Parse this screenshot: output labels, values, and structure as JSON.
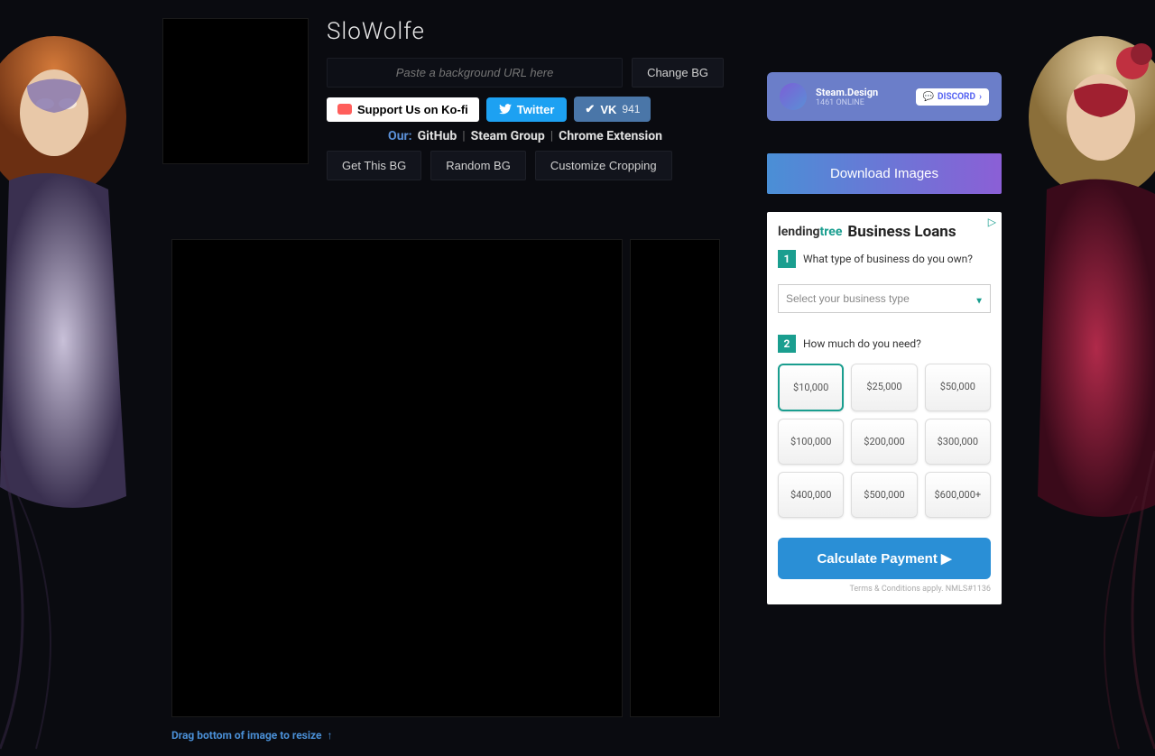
{
  "title": "SloWolfe",
  "urlInput": {
    "placeholder": "Paste a background URL here"
  },
  "buttons": {
    "changeBg": "Change BG",
    "kofi": "Support Us on Ko-fi",
    "twitter": "Twitter",
    "vk": "VK",
    "vkCount": "941",
    "getThisBg": "Get This BG",
    "randomBg": "Random BG",
    "customizeCropping": "Customize Cropping",
    "download": "Download Images"
  },
  "links": {
    "our": "Our:",
    "github": "GitHub",
    "steamGroup": "Steam Group",
    "chromeExtension": "Chrome Extension"
  },
  "discord": {
    "title": "Steam.Design",
    "sub": "1461 ONLINE",
    "label": "DISCORD"
  },
  "ad": {
    "logoText1": "lending",
    "logoText2": "tree",
    "title": "Business Loans",
    "step1": "What type of business do you own?",
    "selectPlaceholder": "Select your business type",
    "step2": "How much do you need?",
    "amounts": [
      "$10,000",
      "$25,000",
      "$50,000",
      "$100,000",
      "$200,000",
      "$300,000",
      "$400,000",
      "$500,000",
      "$600,000+"
    ],
    "cta": "Calculate Payment",
    "footer": "Terms & Conditions apply. NMLS#1136"
  },
  "resizeHint": "Drag bottom of image to resize"
}
